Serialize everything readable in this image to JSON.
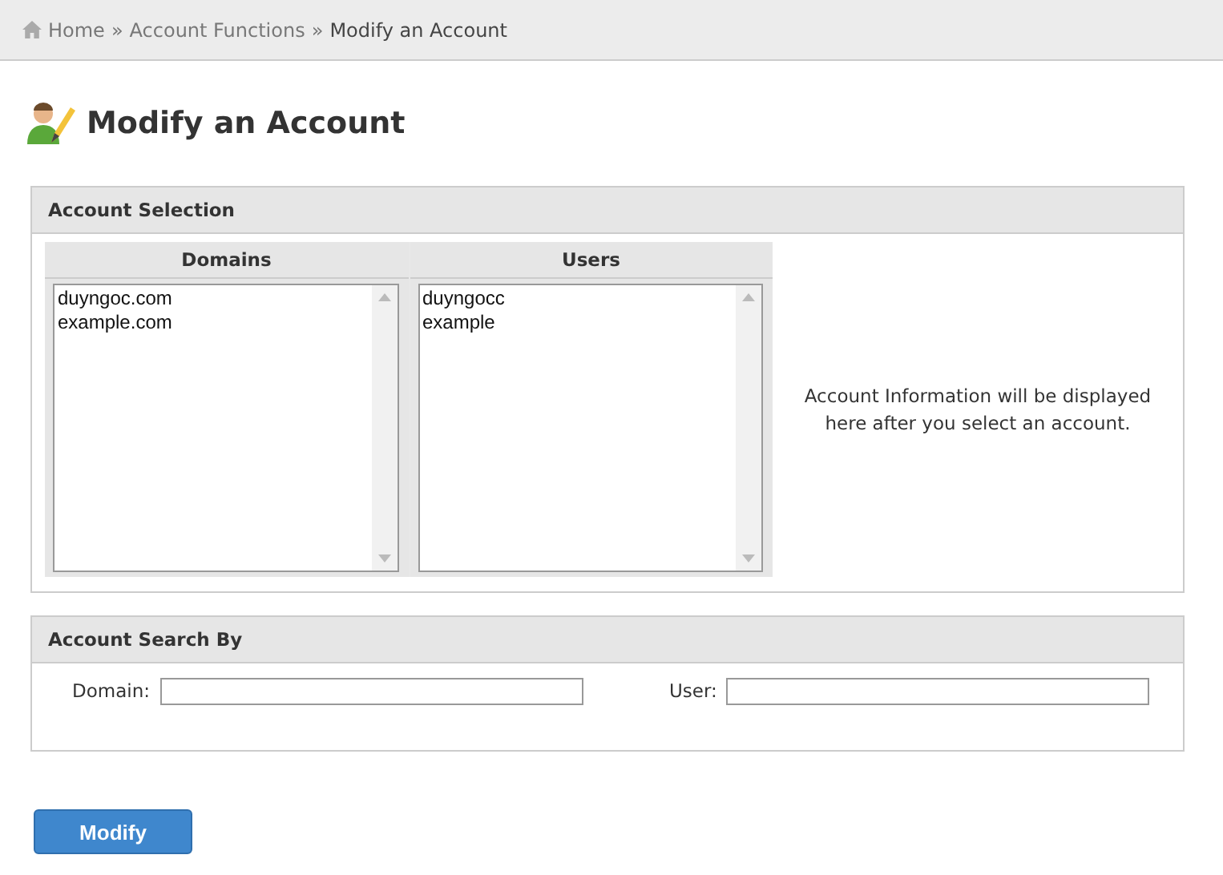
{
  "breadcrumb": [
    {
      "label": "Home",
      "kind": "home"
    },
    {
      "label": "»",
      "kind": "sep"
    },
    {
      "label": "Account Functions",
      "kind": "link"
    },
    {
      "label": "»",
      "kind": "sep"
    },
    {
      "label": "Modify an Account",
      "kind": "current"
    }
  ],
  "page_title": "Modify an Account",
  "account_selection": {
    "title": "Account Selection",
    "lists": [
      {
        "heading": "Domains",
        "items": [
          {
            "label": "duyngoc.com",
            "selected": false
          },
          {
            "label": "example.com",
            "selected": false
          }
        ]
      },
      {
        "heading": "Users",
        "items": [
          {
            "label": "duyngocc",
            "selected": false
          },
          {
            "label": "example",
            "selected": false
          }
        ]
      }
    ],
    "info": "Account Information will be displayed here after you select an account."
  },
  "account_search": {
    "title": "Account Search By",
    "fields": [
      {
        "label": "Domain:"
      },
      {
        "label": "User:"
      }
    ]
  },
  "button": "Modify"
}
